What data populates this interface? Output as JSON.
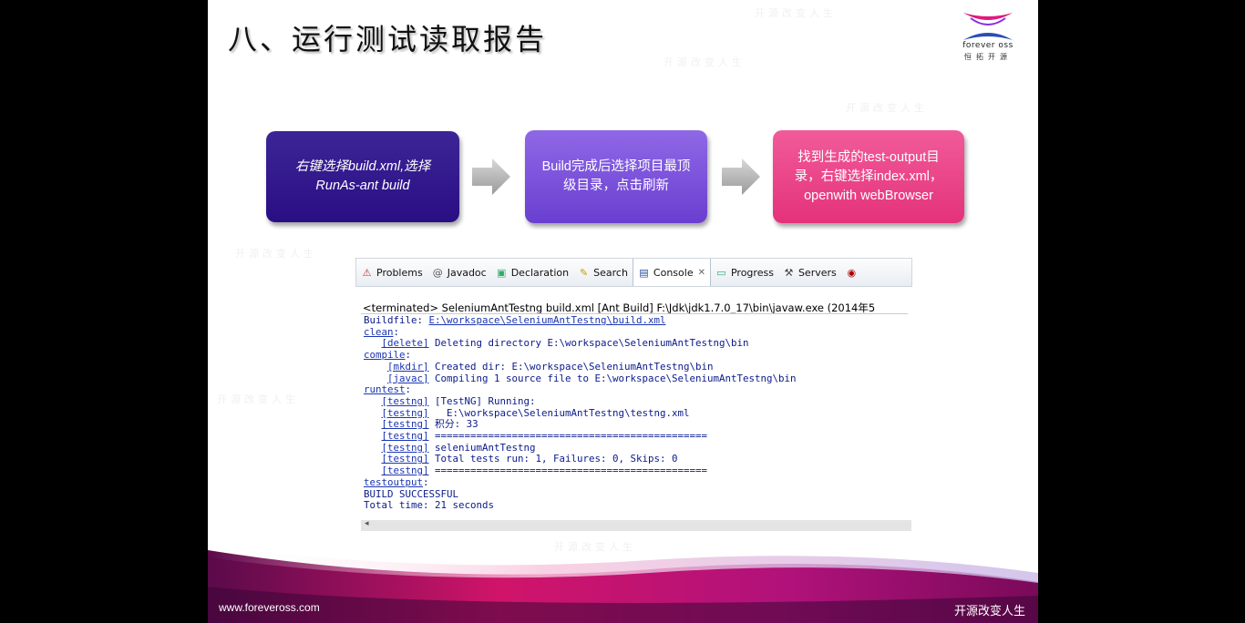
{
  "slide": {
    "title": "八、运行测试读取报告",
    "logo": {
      "brand": "forever oss",
      "cn": "恒拓开源"
    },
    "watermark": "开源改变人生"
  },
  "flow": {
    "step1": "右键选择build.xml,选择RunAs-ant build",
    "step2": "Build完成后选择项目最顶级目录，点击刷新",
    "step3": "找到生成的test-output目录，右键选择index.xml，openwith webBrowser"
  },
  "console": {
    "tabs": [
      {
        "label": "Problems",
        "icon": "problems-icon"
      },
      {
        "label": "Javadoc",
        "icon": "javadoc-icon"
      },
      {
        "label": "Declaration",
        "icon": "declaration-icon"
      },
      {
        "label": "Search",
        "icon": "search-icon"
      },
      {
        "label": "Console",
        "icon": "console-icon",
        "active": true
      },
      {
        "label": "Progress",
        "icon": "progress-icon"
      },
      {
        "label": "Servers",
        "icon": "servers-icon"
      }
    ],
    "terminated": "<terminated> SeleniumAntTestng build.xml [Ant Build] F:\\Jdk\\jdk1.7.0_17\\bin\\javaw.exe (2014年5",
    "buildfile_label": "Buildfile: ",
    "buildfile_path": "E:\\workspace\\SeleniumAntTestng\\build.xml",
    "lines": [
      {
        "indent": "",
        "tag": "clean",
        "suffix": ":",
        "text": ""
      },
      {
        "indent": "   ",
        "tag": "[delete]",
        "suffix": "",
        "text": " Deleting directory E:\\workspace\\SeleniumAntTestng\\bin"
      },
      {
        "indent": "",
        "tag": "compile",
        "suffix": ":",
        "text": ""
      },
      {
        "indent": "    ",
        "tag": "[mkdir]",
        "suffix": "",
        "text": " Created dir: E:\\workspace\\SeleniumAntTestng\\bin"
      },
      {
        "indent": "    ",
        "tag": "[javac]",
        "suffix": "",
        "text": " Compiling 1 source file to E:\\workspace\\SeleniumAntTestng\\bin"
      },
      {
        "indent": "",
        "tag": "runtest",
        "suffix": ":",
        "text": ""
      },
      {
        "indent": "   ",
        "tag": "[testng]",
        "suffix": "",
        "text": " [TestNG] Running:"
      },
      {
        "indent": "   ",
        "tag": "[testng]",
        "suffix": "",
        "text": "   E:\\workspace\\SeleniumAntTestng\\testng.xml"
      },
      {
        "indent": "   ",
        "tag": "[testng]",
        "suffix": "",
        "text": " 积分: 33"
      },
      {
        "indent": "   ",
        "tag": "[testng]",
        "suffix": "",
        "text": " =============================================="
      },
      {
        "indent": "   ",
        "tag": "[testng]",
        "suffix": "",
        "text": " seleniumAntTestng"
      },
      {
        "indent": "   ",
        "tag": "[testng]",
        "suffix": "",
        "text": " Total tests run: 1, Failures: 0, Skips: 0"
      },
      {
        "indent": "   ",
        "tag": "[testng]",
        "suffix": "",
        "text": " =============================================="
      },
      {
        "indent": "",
        "tag": "testoutput",
        "suffix": ":",
        "text": ""
      },
      {
        "indent": "",
        "tag": "",
        "suffix": "",
        "text": "BUILD SUCCESSFUL"
      },
      {
        "indent": "",
        "tag": "",
        "suffix": "",
        "text": "Total time: 21 seconds"
      }
    ],
    "scroll_left": "◂"
  },
  "footer": {
    "url": "www.foreveross.com",
    "slogan": "开源改变人生"
  },
  "colors": {
    "box1": "#2a0e84",
    "box2": "#6a3fd0",
    "box3": "#e4327a",
    "link": "#1b35b3"
  }
}
